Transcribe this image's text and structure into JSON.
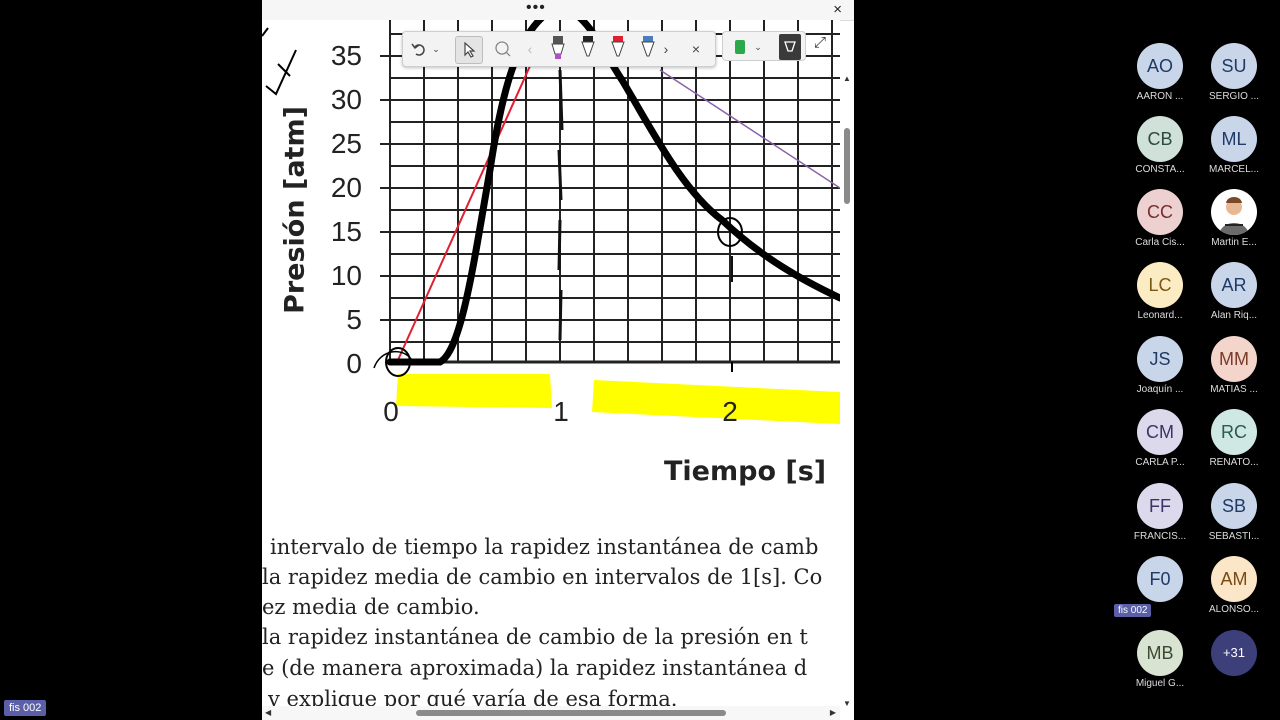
{
  "title_bar": {
    "dots": "•••",
    "close": "×"
  },
  "graph": {
    "ylabel": "Presión [atm]",
    "xlabel": "Tiempo [s]",
    "yticks": [
      "35",
      "30",
      "25",
      "20",
      "15",
      "10",
      "5",
      "0"
    ],
    "xticks": [
      "0",
      "1",
      "2"
    ]
  },
  "doc_lines": [
    "intervalo de tiempo la rapidez instantánea de camb",
    "la rapidez media de cambio en intervalos de 1[s]. Co",
    "ez media de cambio.",
    "la rapidez instantánea de cambio de la presión en t",
    "e (de manera aproximada) la rapidez instantánea d",
    "y explique por qué varía de esa forma."
  ],
  "participants": [
    {
      "initials": "AO",
      "name": "AARON ...",
      "bg": "#c9d6ea",
      "fg": "#1f3a66"
    },
    {
      "initials": "SU",
      "name": "SERGIO ...",
      "bg": "#c9d6ea",
      "fg": "#1f3a66"
    },
    {
      "initials": "CB",
      "name": "CONSTA...",
      "bg": "#d0e1d9",
      "fg": "#2c4a3e"
    },
    {
      "initials": "ML",
      "name": "MARCEL...",
      "bg": "#c9d6ea",
      "fg": "#1f3a66"
    },
    {
      "initials": "CC",
      "name": "Carla Cis...",
      "bg": "#edd1d1",
      "fg": "#7a2d2d"
    },
    {
      "initials": "",
      "name": "Martin E...",
      "bg": "#ffffff",
      "fg": "#000000",
      "photo": true
    },
    {
      "initials": "LC",
      "name": "Leonard...",
      "bg": "#fbecc3",
      "fg": "#7a5a10"
    },
    {
      "initials": "AR",
      "name": "Alan Riq...",
      "bg": "#c9d6ea",
      "fg": "#1f3a66"
    },
    {
      "initials": "JS",
      "name": "Joaquín ...",
      "bg": "#c9d6ea",
      "fg": "#1f3a66"
    },
    {
      "initials": "MM",
      "name": "MATIAS ...",
      "bg": "#f3d5cc",
      "fg": "#7a3a2a"
    },
    {
      "initials": "CM",
      "name": "CARLA P...",
      "bg": "#dcd9ec",
      "fg": "#3a3566"
    },
    {
      "initials": "RC",
      "name": "RENATO...",
      "bg": "#cfe8e3",
      "fg": "#2a5a52"
    },
    {
      "initials": "FF",
      "name": "FRANCIS...",
      "bg": "#dcd9ec",
      "fg": "#3a3566"
    },
    {
      "initials": "SB",
      "name": "SEBASTI...",
      "bg": "#c9d6ea",
      "fg": "#1f3a66"
    },
    {
      "initials": "F0",
      "name": "fis 002",
      "bg": "#c9d6ea",
      "fg": "#1f3a66",
      "badge": true
    },
    {
      "initials": "AM",
      "name": "ALONSO...",
      "bg": "#fbe6c8",
      "fg": "#7a4a15"
    },
    {
      "initials": "MB",
      "name": "Miguel G...",
      "bg": "#d8e3d2",
      "fg": "#3a4a30"
    },
    {
      "initials": "+31",
      "name": "",
      "bg": "#3d3f7a",
      "fg": "#ffffff",
      "more": true
    }
  ],
  "self_view_label": "fis 002",
  "toolbar_icons": [
    "undo-icon",
    "select-arrow-icon",
    "lasso-icon",
    "pen-purple-icon",
    "pen-black-icon",
    "pen-red-icon",
    "highlighter-icon",
    "close-icon",
    "color-green-icon",
    "eraser-icon",
    "expand-icon"
  ],
  "colors": {
    "pen_red": "#e02030",
    "pen_purple": "#b050c8",
    "highlight": "#ffff00",
    "marker_green": "#2aa84a"
  }
}
